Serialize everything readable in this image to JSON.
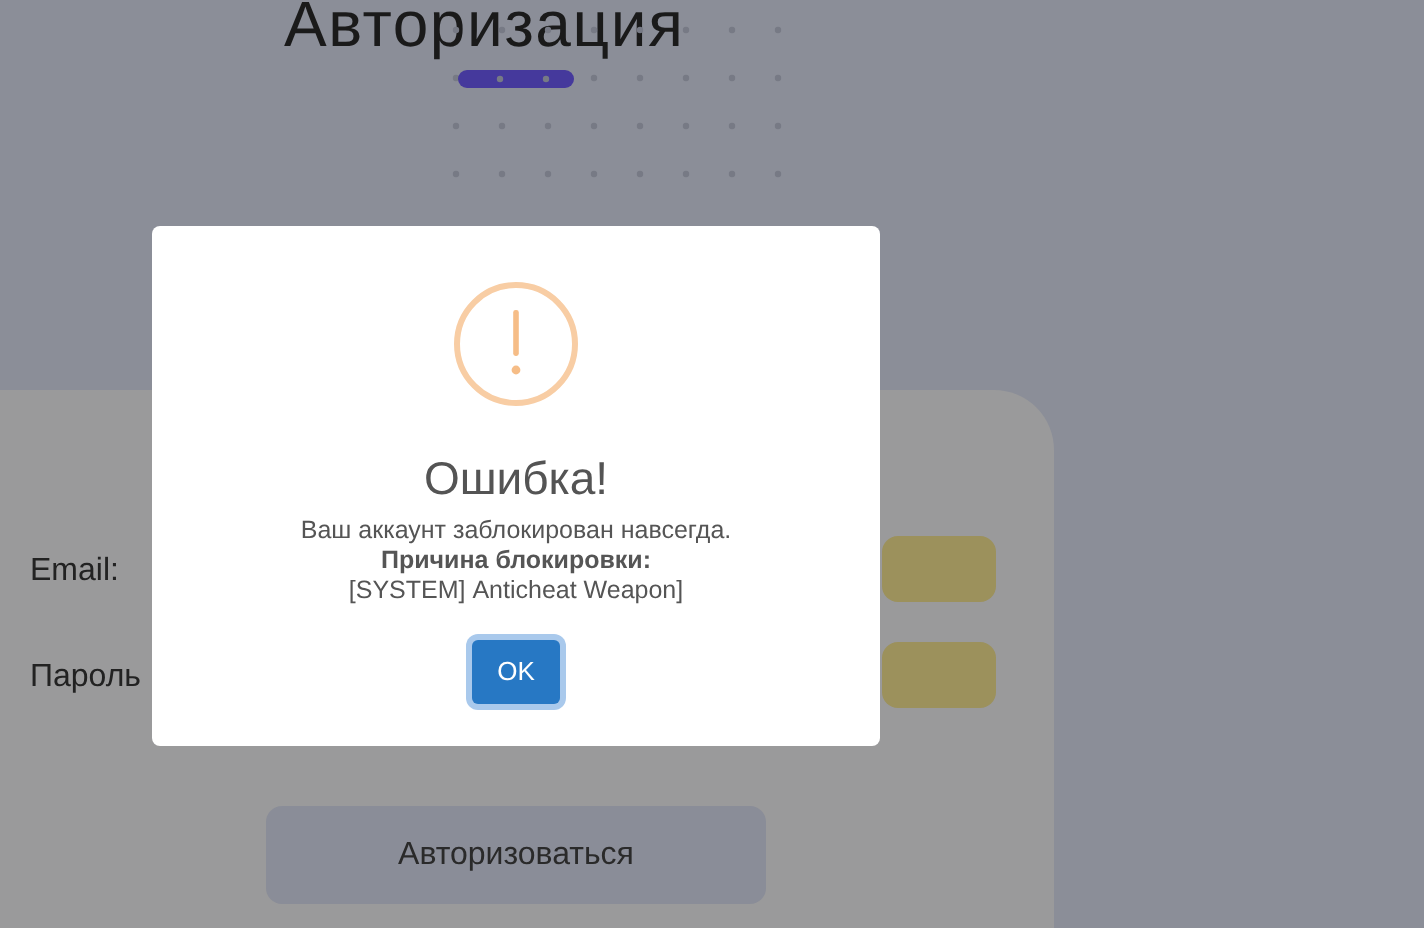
{
  "page": {
    "title": "Авторизация"
  },
  "form": {
    "fields": [
      {
        "label": "Email:"
      },
      {
        "label": "Пароль"
      }
    ],
    "submit": "Авторизоваться"
  },
  "dialog": {
    "title": "Ошибка!",
    "message": "Ваш аккаунт заблокирован навсегда.\n**Причина блокировки:**\n[SYSTEM] Anticheat Weapon]",
    "button": "OK"
  }
}
